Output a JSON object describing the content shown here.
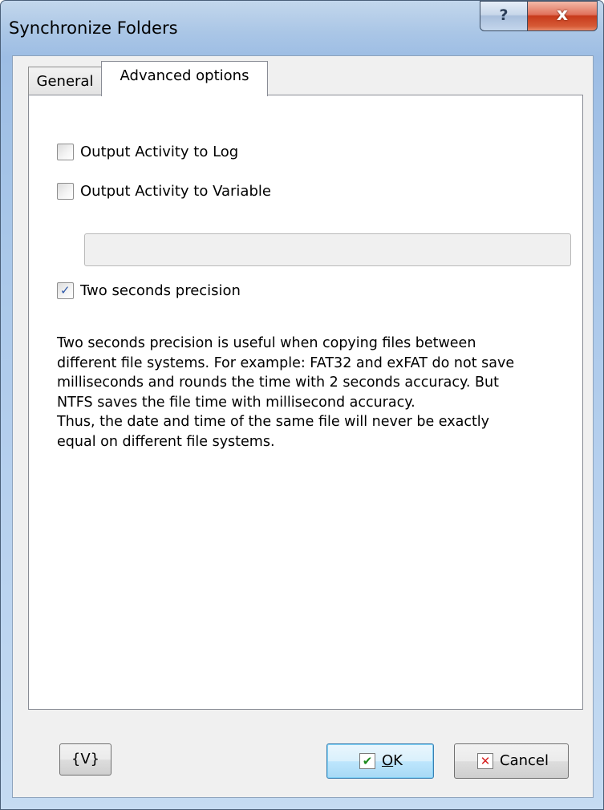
{
  "window": {
    "title": "Synchronize Folders",
    "help_glyph": "?",
    "close_glyph": "x"
  },
  "tabs": [
    {
      "label": "General",
      "selected": false
    },
    {
      "label": "Advanced options",
      "selected": true
    }
  ],
  "options": {
    "log": {
      "label": "Output Activity to Log",
      "checked": false
    },
    "variable": {
      "label": "Output Activity to Variable",
      "checked": false
    },
    "variable_input": {
      "value": "",
      "placeholder": ""
    },
    "precision": {
      "label": "Two seconds precision",
      "checked": true
    }
  },
  "description": {
    "lines": [
      "Two seconds precision is useful when copying files between",
      "different file systems. For example: FAT32 and exFAT do not save",
      "milliseconds and rounds the time with 2 seconds accuracy. But",
      "NTFS saves the file time with millisecond accuracy.",
      "Thus, the date and time of the same file will never be exactly",
      "equal on different file systems."
    ]
  },
  "buttons": {
    "variables_label": "{V}",
    "ok_label_mnemonic": "O",
    "ok_label_rest": "K",
    "cancel_label": "Cancel",
    "ok_icon": "check-icon",
    "cancel_icon": "cross-icon",
    "check_glyph": "✔",
    "cross_glyph": "✕"
  },
  "checkmark_glyph": "✓"
}
